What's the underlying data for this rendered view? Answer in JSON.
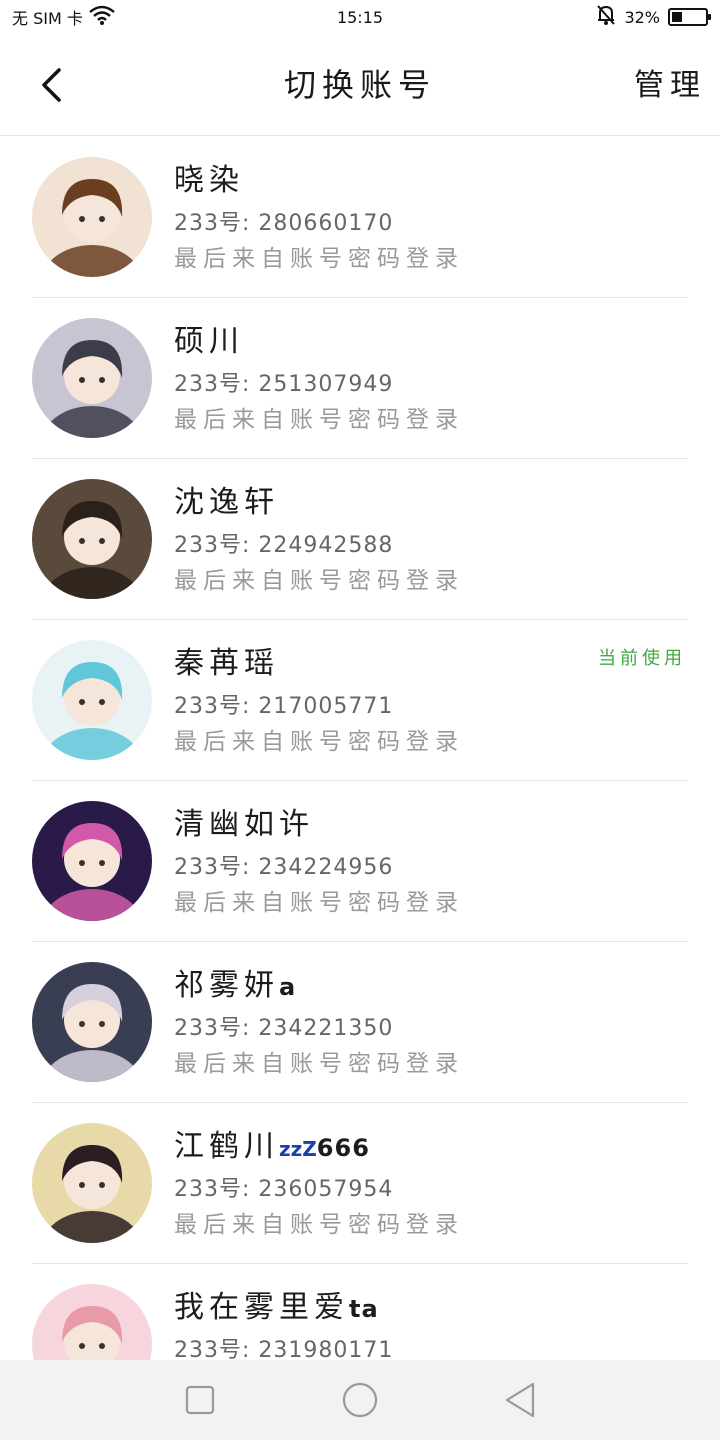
{
  "status_bar": {
    "carrier": "无 SIM 卡",
    "time": "15:15",
    "battery_text": "32%",
    "battery_level": 0.32
  },
  "header": {
    "back_icon": "chevron-left-icon",
    "title": "切换账号",
    "manage_label": "管理"
  },
  "accounts": [
    {
      "name": "晓染",
      "name_suffix": "",
      "id_text": "233号: 280660170",
      "login_text": "最后来自账号密码登录",
      "badge": "",
      "avatar_colors": [
        "#f1e2d4",
        "#6b3e22"
      ]
    },
    {
      "name": "硕川",
      "name_suffix": "",
      "id_text": "233号: 251307949",
      "login_text": "最后来自账号密码登录",
      "badge": "",
      "avatar_colors": [
        "#c9c4d2",
        "#3c3c4a"
      ]
    },
    {
      "name": "沈逸轩",
      "name_suffix": "",
      "id_text": "233号: 224942588",
      "login_text": "最后来自账号密码登录",
      "badge": "",
      "avatar_colors": [
        "#5a4a3c",
        "#2b2119"
      ]
    },
    {
      "name": "秦苒瑶",
      "name_suffix": "",
      "id_text": "233号: 217005771",
      "login_text": "最后来自账号密码登录",
      "badge": "当前使用",
      "avatar_colors": [
        "#e9f3f6",
        "#5fc7d9"
      ]
    },
    {
      "name": "清幽如许",
      "name_suffix": "",
      "id_text": "233号: 234224956",
      "login_text": "最后来自账号密码登录",
      "badge": "",
      "avatar_colors": [
        "#2a1a4a",
        "#d15aa8"
      ]
    },
    {
      "name": "祁雾妍",
      "name_suffix": "a",
      "id_text": "233号: 234221350",
      "login_text": "最后来自账号密码登录",
      "badge": "",
      "avatar_colors": [
        "#3a3e52",
        "#d6d0dc"
      ]
    },
    {
      "name": "江鹤川",
      "name_suffix": "666",
      "zzz": "zzZ",
      "id_text": "233号: 236057954",
      "login_text": "最后来自账号密码登录",
      "badge": "",
      "avatar_colors": [
        "#e8d9a8",
        "#2a1e22"
      ]
    },
    {
      "name": "我在雾里爱",
      "name_suffix": "ta",
      "id_text": "233号: 231980171",
      "login_text": "",
      "badge": "",
      "avatar_colors": [
        "#f6d6dc",
        "#e99aa8"
      ]
    }
  ],
  "nav_bar": {
    "icons": [
      "square-recents-icon",
      "circle-home-icon",
      "triangle-back-icon"
    ]
  }
}
